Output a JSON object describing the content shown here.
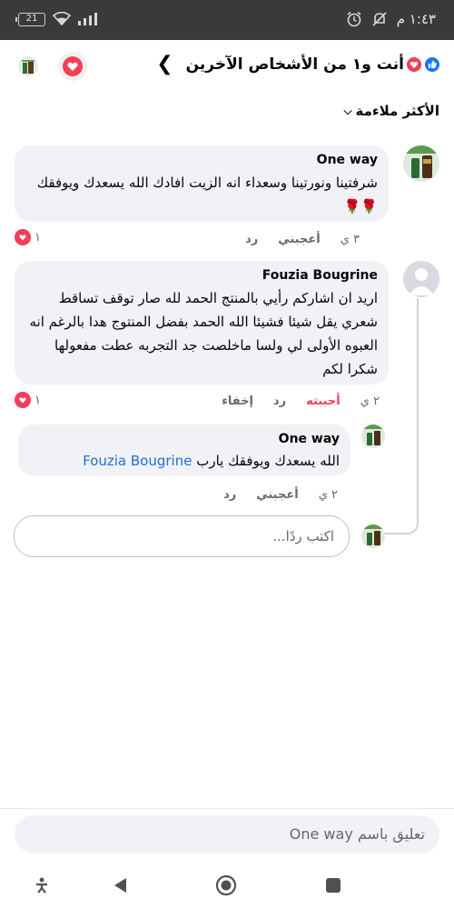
{
  "status_bar": {
    "time": "١:٤٣ م",
    "battery": "21"
  },
  "header": {
    "title": "أنت و١ من الأشخاص الآخرين"
  },
  "sort": {
    "label": "الأكثر ملاءمة"
  },
  "comments": [
    {
      "author": "One way",
      "text": "شرفتينا ونورتينا وسعداء انه الزيت افادك الله يسعدك ويوفقك 🌹🌹",
      "time": "٣ ي",
      "like_label": "أعجبني",
      "reply_label": "رد",
      "reaction_count": "١"
    },
    {
      "author": "Fouzia Bougrine",
      "text": "اريد ان اشاركم رأيي بالمنتج الحمد لله صار توقف تساقط شعري يقل شيئا فشيئا الله الحمد بفضل المنتوج هدا بالرغم انه العبوه الأولى لي ولسا ماخلصت جد التجربه عطت مفعولها شكرا لكم",
      "time": "٢ ي",
      "like_label": "أحببته",
      "reply_label": "رد",
      "hide_label": "إخفاء",
      "reaction_count": "١"
    }
  ],
  "reply": {
    "author": "One way",
    "text_before": "الله يسعدك ويوفقك يارب",
    "mention": "Fouzia Bougrine",
    "time": "٢ ي",
    "like_label": "أعجبني",
    "reply_label": "رد"
  },
  "reply_input": {
    "placeholder": "اكتب ردًا..."
  },
  "comment_input": {
    "placeholder": "تعليق باسم One way"
  },
  "colors": {
    "like_blue": "#1877f2",
    "love_red": "#f33e58",
    "mention_blue": "#216fdb",
    "bubble_gray": "#f0f2f5"
  }
}
